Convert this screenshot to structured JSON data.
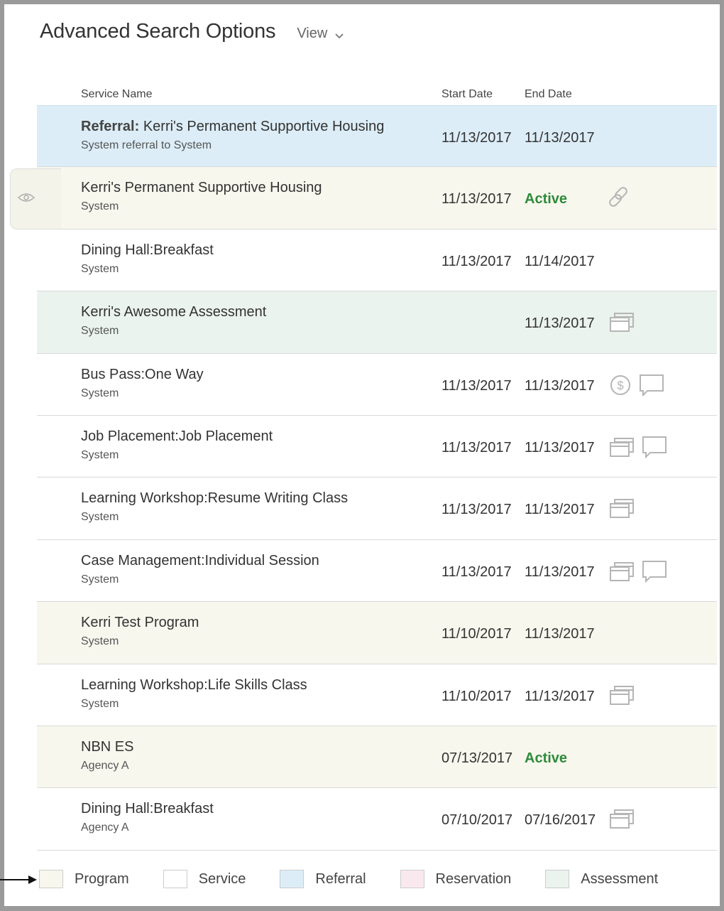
{
  "header": {
    "title": "Advanced Search Options",
    "view_label": "View"
  },
  "columns": {
    "service_name": "Service Name",
    "start_date": "Start Date",
    "end_date": "End Date"
  },
  "rows": [
    {
      "type": "referral",
      "prefix": "Referral:",
      "name": " Kerri's Permanent Supportive Housing",
      "sub": "System referral to System",
      "start": "11/13/2017",
      "end": "11/13/2017",
      "end_active": false,
      "icons": []
    },
    {
      "type": "program",
      "prefix": "",
      "name": "Kerri's Permanent Supportive Housing",
      "sub": "System",
      "start": "11/13/2017",
      "end": "Active",
      "end_active": true,
      "icons": [
        "link-icon"
      ]
    },
    {
      "type": "service",
      "prefix": "",
      "name": "Dining Hall:Breakfast",
      "sub": "System",
      "start": "11/13/2017",
      "end": "11/14/2017",
      "end_active": false,
      "icons": []
    },
    {
      "type": "assessment",
      "prefix": "",
      "name": "Kerri's Awesome Assessment",
      "sub": "System",
      "start": "",
      "end": "11/13/2017",
      "end_active": false,
      "icons": [
        "windows-icon"
      ]
    },
    {
      "type": "service",
      "prefix": "",
      "name": "Bus Pass:One Way",
      "sub": "System",
      "start": "11/13/2017",
      "end": "11/13/2017",
      "end_active": false,
      "icons": [
        "dollar-icon",
        "comment-icon"
      ]
    },
    {
      "type": "service",
      "prefix": "",
      "name": "Job Placement:Job Placement",
      "sub": "System",
      "start": "11/13/2017",
      "end": "11/13/2017",
      "end_active": false,
      "icons": [
        "windows-icon",
        "comment-icon"
      ]
    },
    {
      "type": "service",
      "prefix": "",
      "name": "Learning Workshop:Resume Writing Class",
      "sub": "System",
      "start": "11/13/2017",
      "end": "11/13/2017",
      "end_active": false,
      "icons": [
        "windows-icon"
      ]
    },
    {
      "type": "service",
      "prefix": "",
      "name": "Case Management:Individual Session",
      "sub": "System",
      "start": "11/13/2017",
      "end": "11/13/2017",
      "end_active": false,
      "icons": [
        "windows-icon",
        "comment-icon"
      ]
    },
    {
      "type": "program",
      "prefix": "",
      "name": "Kerri Test Program",
      "sub": "System",
      "start": "11/10/2017",
      "end": "11/13/2017",
      "end_active": false,
      "icons": []
    },
    {
      "type": "service",
      "prefix": "",
      "name": "Learning Workshop:Life Skills Class",
      "sub": "System",
      "start": "11/10/2017",
      "end": "11/13/2017",
      "end_active": false,
      "icons": [
        "windows-icon"
      ]
    },
    {
      "type": "program",
      "prefix": "",
      "name": "NBN ES",
      "sub": "Agency A",
      "start": "07/13/2017",
      "end": "Active",
      "end_active": true,
      "icons": []
    },
    {
      "type": "service",
      "prefix": "",
      "name": "Dining Hall:Breakfast",
      "sub": "Agency A",
      "start": "07/10/2017",
      "end": "07/16/2017",
      "end_active": false,
      "icons": [
        "windows-icon"
      ]
    }
  ],
  "legend": [
    {
      "label": "Program",
      "color": "#f7f7ee"
    },
    {
      "label": "Service",
      "color": "#ffffff"
    },
    {
      "label": "Referral",
      "color": "#dcedf7"
    },
    {
      "label": "Reservation",
      "color": "#f9e9ee"
    },
    {
      "label": "Assessment",
      "color": "#eaf3ee"
    }
  ],
  "colors": {
    "active": "#2e8b3a",
    "icon_gray": "#b5b5b5"
  }
}
